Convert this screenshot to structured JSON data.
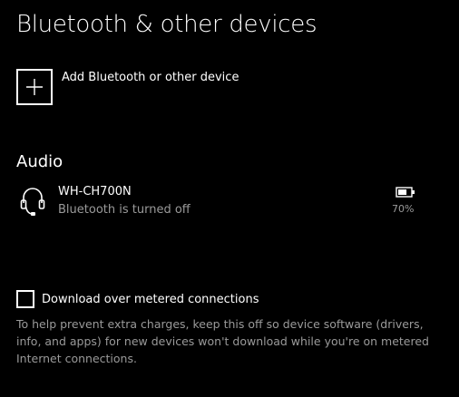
{
  "header": {
    "title": "Bluetooth & other devices"
  },
  "add_device": {
    "label": "Add Bluetooth or other device",
    "icon": "plus-icon"
  },
  "audio": {
    "section_title": "Audio",
    "devices": [
      {
        "name": "WH-CH700N",
        "status": "Bluetooth is turned off",
        "icon": "headset-icon",
        "battery_icon": "battery-icon",
        "battery": "70%",
        "battery_fraction": 0.7
      }
    ]
  },
  "metered": {
    "label": "Download over metered connections",
    "checked": false,
    "help": "To help prevent extra charges, keep this off so device software (drivers, info, and apps) for new devices won't download while you're on metered Internet connections."
  },
  "colors": {
    "background": "#000000",
    "text": "#ffffff",
    "secondary_text": "#9a9a9a"
  }
}
